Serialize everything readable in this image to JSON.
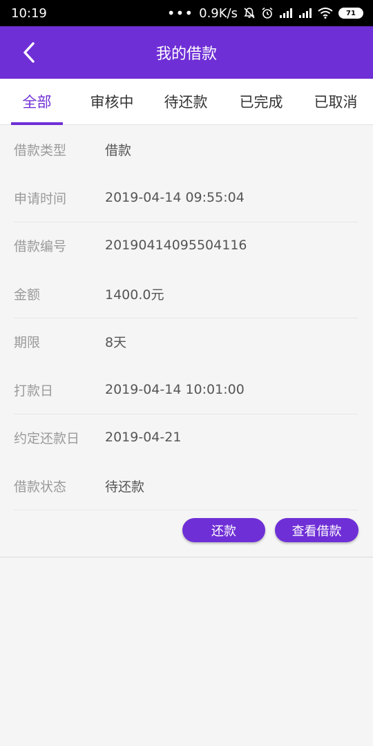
{
  "status_bar": {
    "time": "10:19",
    "dots": "•••",
    "net_speed": "0.9K/s",
    "battery": "71"
  },
  "header": {
    "title": "我的借款",
    "back_icon": "chevron-left-icon"
  },
  "tabs": [
    {
      "label": "全部",
      "active": true
    },
    {
      "label": "审核中"
    },
    {
      "label": "待还款"
    },
    {
      "label": "已完成"
    },
    {
      "label": "已取消"
    }
  ],
  "loan": {
    "rows": [
      {
        "label": "借款类型",
        "value": "借款"
      },
      {
        "label": "申请时间",
        "value": "2019-04-14 09:55:04"
      },
      {
        "label": "借款编号",
        "value": "20190414095504116"
      },
      {
        "label": "金额",
        "value": "1400.0元"
      },
      {
        "label": "期限",
        "value": "8天"
      },
      {
        "label": "打款日",
        "value": "2019-04-14 10:01:00"
      },
      {
        "label": "约定还款日",
        "value": "2019-04-21"
      },
      {
        "label": "借款状态",
        "value": "待还款"
      }
    ],
    "repay_button": "还款",
    "view_button": "查看借款"
  },
  "colors": {
    "accent": "#6f2fd6",
    "label_text": "#9a9a9a",
    "value_text": "#555555"
  }
}
